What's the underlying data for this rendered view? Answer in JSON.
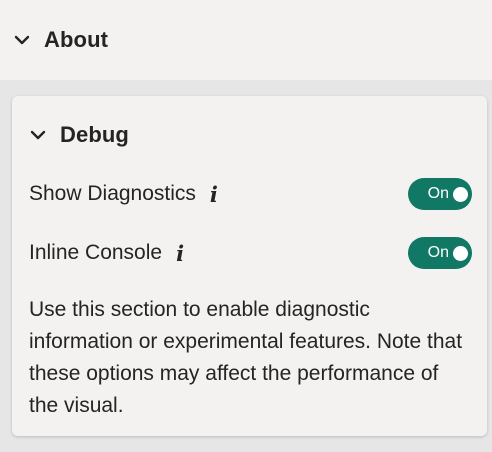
{
  "about": {
    "title": "About"
  },
  "debug": {
    "title": "Debug",
    "rows": [
      {
        "label": "Show Diagnostics",
        "toggle": "On"
      },
      {
        "label": "Inline Console",
        "toggle": "On"
      }
    ],
    "description": "Use this section to enable diagnostic information or experimental features. Note that these options may affect the performance of the visual."
  },
  "icons": {
    "chevron": "chevron-down-icon",
    "info": "info-icon"
  },
  "colors": {
    "accent": "#117865",
    "panel": "#f3f2f1",
    "background": "#e6e6e6",
    "text": "#252423"
  }
}
